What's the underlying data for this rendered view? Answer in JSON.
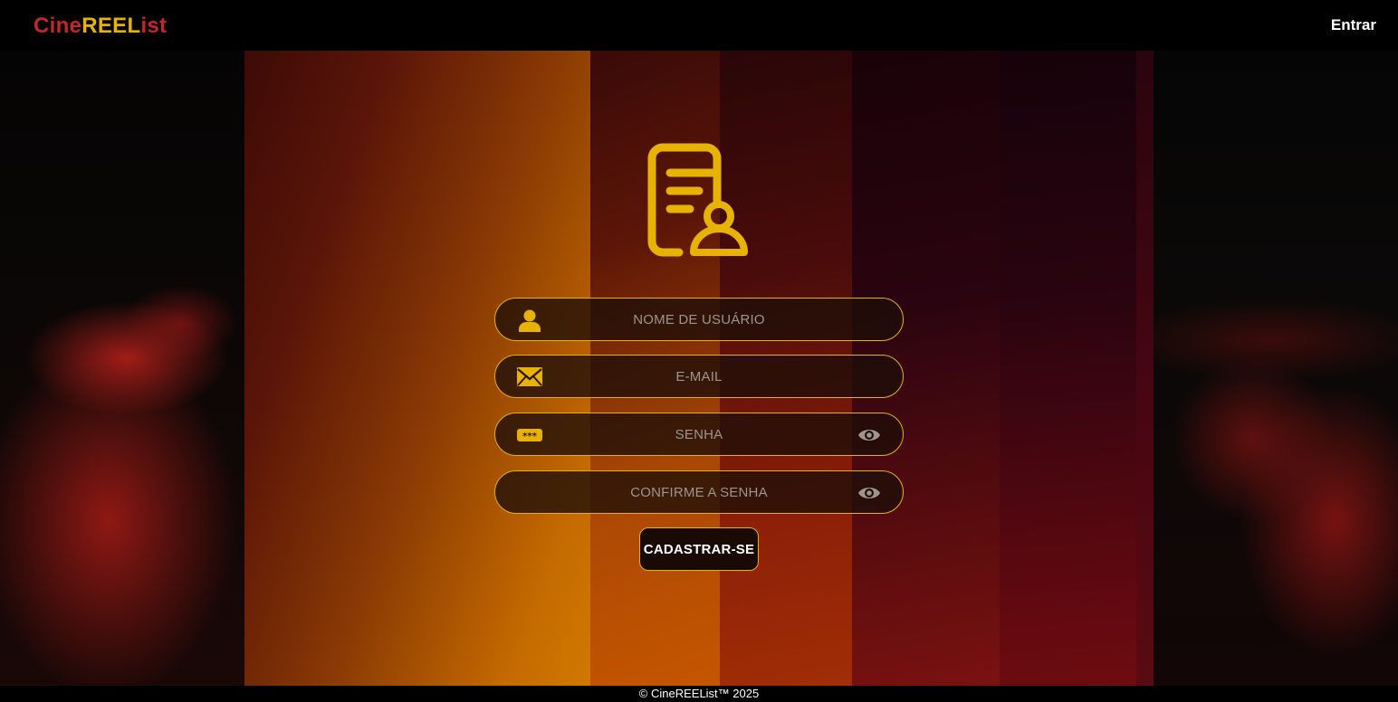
{
  "brand": {
    "part1": "Cine",
    "part2": "REEL",
    "part3": "ist",
    "color_red": "#c2272d",
    "color_gold": "#e8b200"
  },
  "nav": {
    "login": "Entrar"
  },
  "hero_icon": "document-user-icon",
  "form": {
    "username": {
      "placeholder": "NOME DE USUÁRIO",
      "icon": "user-icon"
    },
    "email": {
      "placeholder": "E-MAIL",
      "icon": "envelope-icon"
    },
    "password": {
      "placeholder": "SENHA",
      "icon": "password-dots-icon",
      "toggle_icon": "eye-icon"
    },
    "confirm_password": {
      "placeholder": "CONFIRME A SENHA",
      "toggle_icon": "eye-icon"
    },
    "submit_label": "CADASTRAR-SE"
  },
  "footer": {
    "text": "© CineREEList™ 2025"
  }
}
